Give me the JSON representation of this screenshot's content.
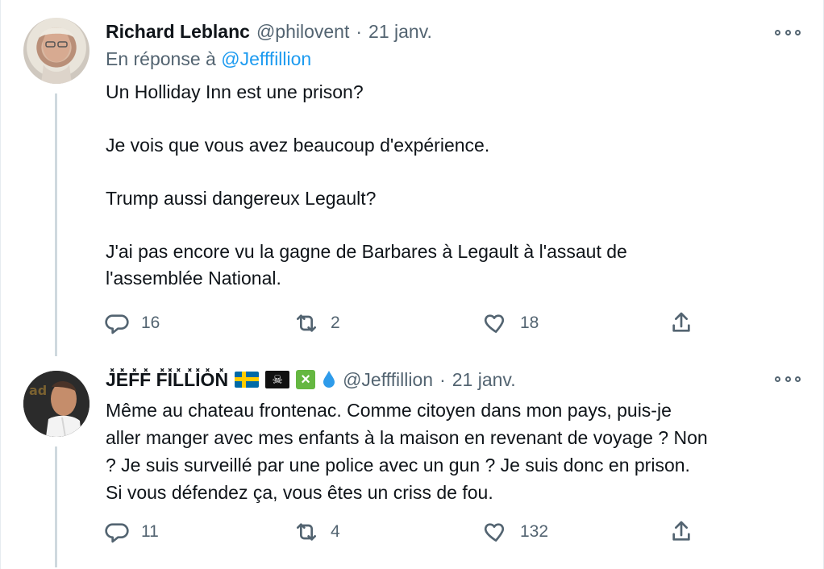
{
  "tweets": [
    {
      "author": {
        "name": "Richard Leblanc",
        "handle": "@philovent",
        "date": "21 janv."
      },
      "reply_prefix": "En réponse à",
      "reply_to": "@Jefffillion",
      "text": "Un Holliday Inn est une prison?\n\nJe vois que vous avez beaucoup d'expérience.\n\nTrump aussi dangereux Legault?\n\nJ'ai pas encore vu la gagne de Barbares à Legault à l'assaut de\nl'assemblée National.",
      "actions": {
        "replies": "16",
        "retweets": "2",
        "likes": "18"
      }
    },
    {
      "author": {
        "name": "J̽E̽F̽F̽ F̽I̽L̽L̽I̽O̽N̽",
        "handle": "@Jefffillion",
        "date": "21 janv."
      },
      "text": "Même au chateau frontenac. Comme citoyen dans mon pays, puis-je\naller manger avec mes enfants à la maison en revenant de voyage ? Non\n? Je suis surveillé par une police avec un gun ? Je suis donc en prison.\nSi vous défendez ça, vous êtes un criss de fou.",
      "actions": {
        "replies": "11",
        "retweets": "4",
        "likes": "132"
      }
    }
  ],
  "separator": "·",
  "icons": {
    "reply": "reply-icon",
    "retweet": "retweet-icon",
    "like": "heart-icon",
    "share": "share-icon",
    "more": "more-icon",
    "flag": "sweden-flag-icon",
    "pirate": "pirate-flag-icon",
    "check": "cross-mark-button-icon",
    "drop": "droplet-icon"
  },
  "colors": {
    "link": "#1d9bf0",
    "muted": "#536471",
    "thread": "#cfd9de"
  }
}
